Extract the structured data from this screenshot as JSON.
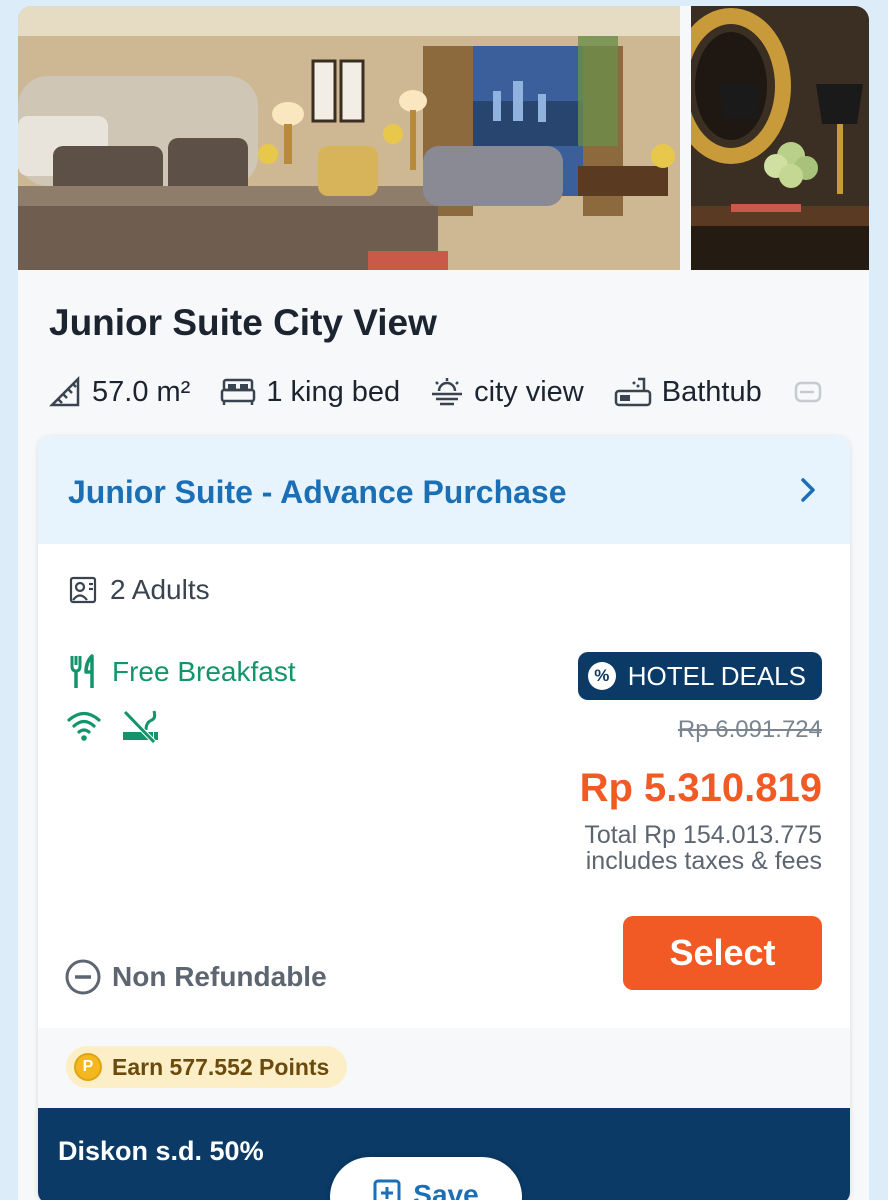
{
  "room": {
    "title": "Junior Suite City View",
    "amenities": [
      {
        "icon": "room-size-icon",
        "label": "57.0 m²"
      },
      {
        "icon": "bed-icon",
        "label": "1 king bed"
      },
      {
        "icon": "city-view-icon",
        "label": "city view"
      },
      {
        "icon": "bathtub-icon",
        "label": "Bathtub"
      }
    ]
  },
  "rate": {
    "name": "Junior Suite - Advance Purchase",
    "occupancy": "2 Adults",
    "breakfast": "Free Breakfast",
    "deal_badge": "HOTEL DEALS",
    "deal_badge_symbol": "%",
    "original_price": "Rp 6.091.724",
    "price": "Rp 5.310.819",
    "total_line1": "Total Rp 154.013.775",
    "total_line2": "includes taxes & fees",
    "select_label": "Select",
    "refund_policy": "Non Refundable",
    "points": "Earn 577.552 Points",
    "points_symbol": "P"
  },
  "promo": {
    "text": "Diskon s.d. 50%"
  },
  "save": {
    "label": "Save"
  },
  "colors": {
    "accent_blue": "#1a6fb5",
    "navy": "#0b3a66",
    "orange": "#f15a24",
    "green": "#13956b"
  }
}
